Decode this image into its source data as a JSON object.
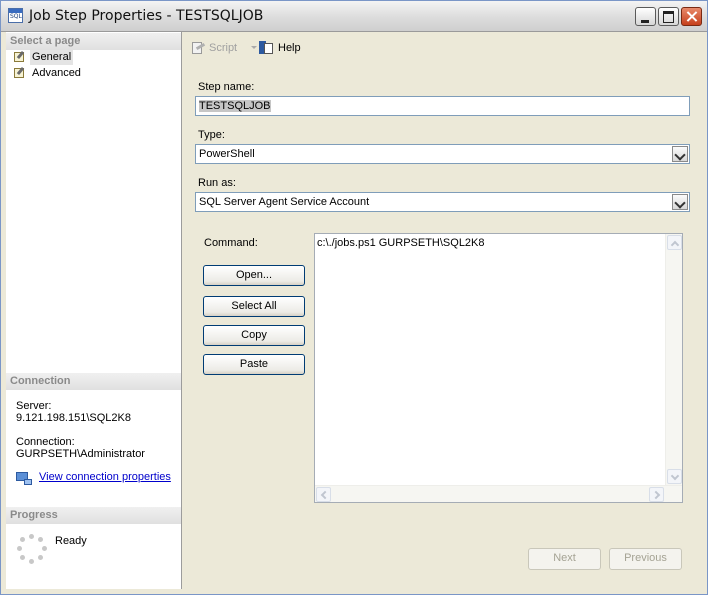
{
  "window": {
    "title": "Job Step Properties - TESTSQLJOB"
  },
  "left": {
    "select_page_header": "Select a page",
    "pages": [
      {
        "label": "General",
        "icon": "wrench-page-icon",
        "selected": true
      },
      {
        "label": "Advanced",
        "icon": "wrench-page-icon",
        "selected": false
      }
    ],
    "connection_header": "Connection",
    "server_label": "Server:",
    "server_value": "9.121.198.151\\SQL2K8",
    "connection_label": "Connection:",
    "connection_value": "GURPSETH\\Administrator",
    "view_connection_link": "View connection properties",
    "progress_header": "Progress",
    "progress_status": "Ready"
  },
  "toolbar": {
    "script_label": "Script",
    "help_label": "Help"
  },
  "form": {
    "step_name_label": "Step name:",
    "step_name_value": "TESTSQLJOB",
    "type_label": "Type:",
    "type_value": "PowerShell",
    "run_as_label": "Run as:",
    "run_as_value": "SQL Server Agent Service Account",
    "command_label": "Command:",
    "command_value": "c:\\./jobs.ps1 GURPSETH\\SQL2K8",
    "buttons": {
      "open": "Open...",
      "select_all": "Select All",
      "copy": "Copy",
      "paste": "Paste"
    }
  },
  "nav": {
    "next": "Next",
    "previous": "Previous"
  },
  "colors": {
    "link": "#0000cc",
    "header_text": "#8a8a8a",
    "button_border": "#003c74"
  }
}
